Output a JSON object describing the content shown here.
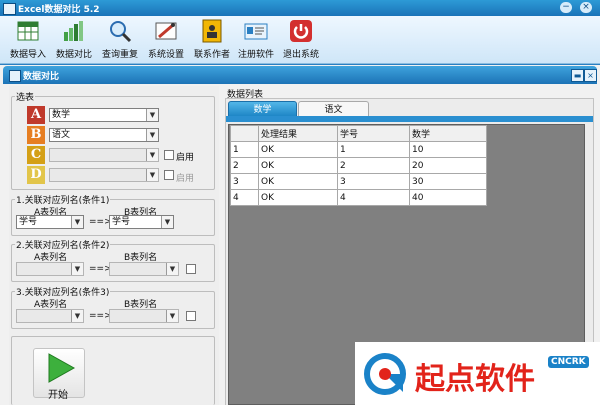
{
  "app": {
    "title": "Excel数据对比 5.2"
  },
  "window_controls": {
    "minimize": "−",
    "close": "×"
  },
  "toolbar": [
    {
      "label": "数据导入",
      "icon": "data-import-icon",
      "color": "#2f7d32"
    },
    {
      "label": "数据对比",
      "icon": "bar-chart-icon",
      "color": "#3e9b3a"
    },
    {
      "label": "查询重复",
      "icon": "magnifier-icon",
      "color": "#2b6cb0"
    },
    {
      "label": "系统设置",
      "icon": "settings-icon",
      "color": "#c0392b"
    },
    {
      "label": "联系作者",
      "icon": "contact-book-icon",
      "color": "#e0a400"
    },
    {
      "label": "注册软件",
      "icon": "register-card-icon",
      "color": "#2a7fc2"
    },
    {
      "label": "退出系统",
      "icon": "power-icon",
      "color": "#d32f2f"
    }
  ],
  "subwindow": {
    "title": "数据对比",
    "minimize": "▬",
    "close": "×"
  },
  "select_table": {
    "legend": "选表",
    "rows": [
      {
        "letter": "A",
        "value": "数学",
        "color": "#c0392b",
        "enabled": true
      },
      {
        "letter": "B",
        "value": "语文",
        "color": "#e67e22",
        "enabled": true
      },
      {
        "letter": "C",
        "value": "",
        "color": "#d4a017",
        "enabled": false,
        "check_label": "启用"
      },
      {
        "letter": "D",
        "value": "",
        "color": "#e2c54a",
        "enabled": false,
        "check_label": "启用"
      }
    ]
  },
  "conditions": [
    {
      "legend": "1.关联对应列名(条件1)",
      "a_label": "A表列名",
      "b_label": "B表列名",
      "a_value": "学号",
      "b_value": "学号",
      "arrow": "==>",
      "enabled": true
    },
    {
      "legend": "2.关联对应列名(条件2)",
      "a_label": "A表列名",
      "b_label": "B表列名",
      "a_value": "",
      "b_value": "",
      "arrow": "==>",
      "enabled": false
    },
    {
      "legend": "3.关联对应列名(条件3)",
      "a_label": "A表列名",
      "b_label": "B表列名",
      "a_value": "",
      "b_value": "",
      "arrow": "==>",
      "enabled": false
    }
  ],
  "start_button": {
    "label": "开始"
  },
  "data_list": {
    "title": "数据列表",
    "tabs": [
      "数学",
      "语文"
    ],
    "active_tab": 0,
    "columns": [
      "",
      "处理结果",
      "学号",
      "数学"
    ],
    "rows": [
      [
        "1",
        "OK",
        "1",
        "10"
      ],
      [
        "2",
        "OK",
        "2",
        "20"
      ],
      [
        "3",
        "OK",
        "3",
        "30"
      ],
      [
        "4",
        "OK",
        "4",
        "40"
      ]
    ]
  },
  "watermark": {
    "name": "起点软件",
    "domain": "CNCRK",
    "color": "#e2231a",
    "accent": "#1a82c8"
  }
}
